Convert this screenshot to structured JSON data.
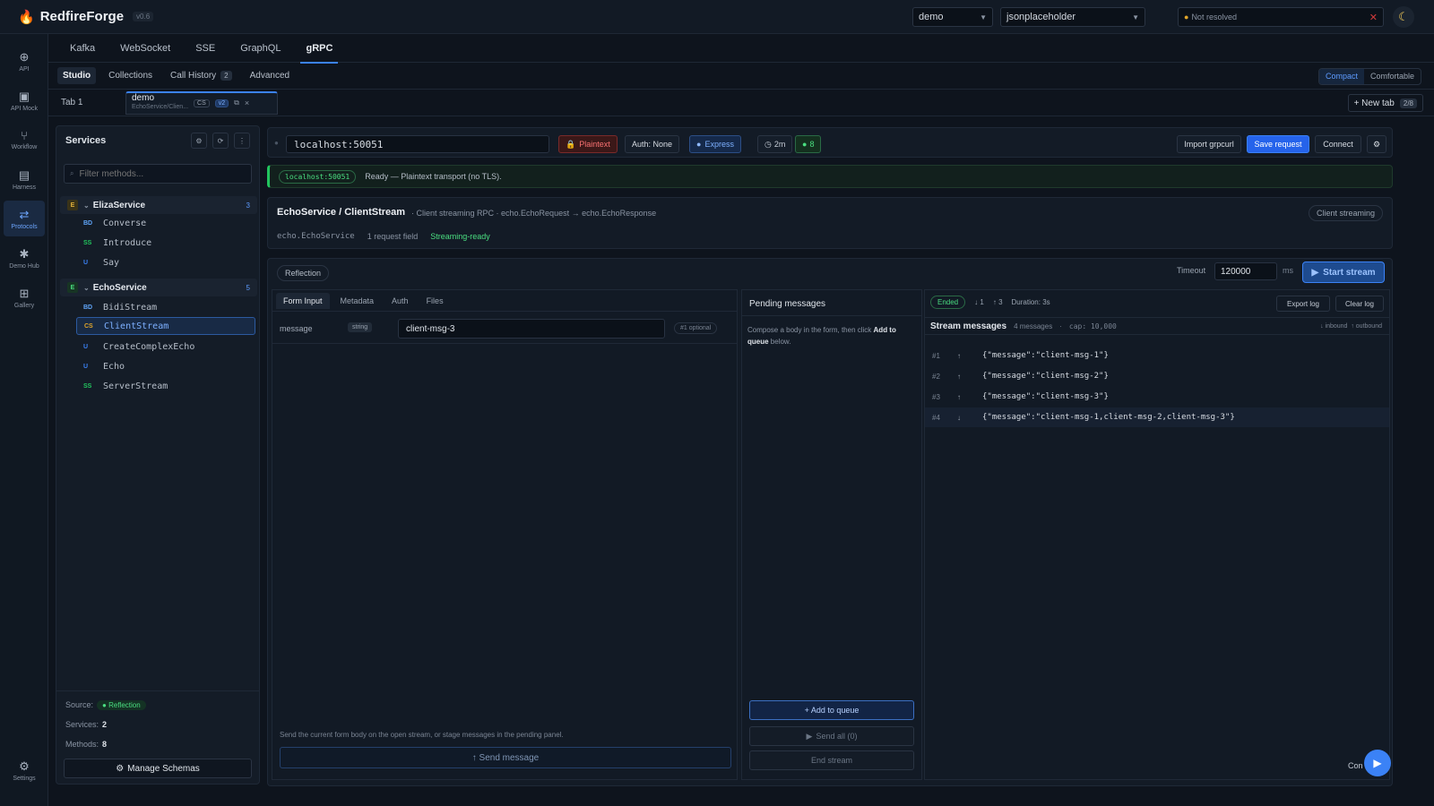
{
  "app": {
    "name": "RedfireForge",
    "version": "v0.6"
  },
  "topbar": {
    "workspace": "demo",
    "collection": "jsonplaceholder",
    "env_status": "Not resolved",
    "theme_icon": "moon-icon"
  },
  "rail": [
    {
      "label": "API",
      "icon": "globe-icon"
    },
    {
      "label": "API Mock",
      "icon": "mock-icon"
    },
    {
      "label": "Workflow",
      "icon": "workflow-icon"
    },
    {
      "label": "Harness",
      "icon": "harness-icon"
    },
    {
      "label": "Protocols",
      "icon": "protocols-icon",
      "active": true
    },
    {
      "label": "Demo Hub",
      "icon": "hub-icon"
    },
    {
      "label": "Gallery",
      "icon": "gallery-icon"
    },
    {
      "label": "Settings",
      "icon": "gear-icon"
    }
  ],
  "protocol_tabs": [
    "Kafka",
    "WebSocket",
    "SSE",
    "GraphQL",
    "gRPC"
  ],
  "active_protocol": "gRPC",
  "sub_tabs": {
    "studio": "Studio",
    "collections": "Collections",
    "history": "Call History",
    "history_count": "2",
    "advanced": "Advanced"
  },
  "density": {
    "compact": "Compact",
    "comfortable": "Comfortable"
  },
  "request_tabs": {
    "tab1": "Tab 1",
    "tab2_name": "demo",
    "tab2_sub": "EchoService/Clien...",
    "tab2_badge1": "CS",
    "tab2_badge2": "v2",
    "new_tab": "+ New tab",
    "tab_count": "2/8"
  },
  "services_panel": {
    "title": "Services",
    "filter_placeholder": "Filter methods...",
    "services": [
      {
        "name": "ElizaService",
        "count": "3",
        "methods": [
          {
            "tag": "BD",
            "name": "Converse"
          },
          {
            "tag": "SS",
            "name": "Introduce"
          },
          {
            "tag": "U",
            "name": "Say"
          }
        ]
      },
      {
        "name": "EchoService",
        "count": "5",
        "methods": [
          {
            "tag": "BD",
            "name": "BidiStream"
          },
          {
            "tag": "CS",
            "name": "ClientStream",
            "active": true
          },
          {
            "tag": "U",
            "name": "CreateComplexEcho"
          },
          {
            "tag": "U",
            "name": "Echo"
          },
          {
            "tag": "SS",
            "name": "ServerStream"
          }
        ]
      }
    ],
    "source_label": "Source:",
    "source_value": "Reflection",
    "services_label": "Services:",
    "services_count": "2",
    "methods_label": "Methods:",
    "methods_count": "8",
    "manage_button": "Manage Schemas"
  },
  "url_bar": {
    "url": "localhost:50051",
    "transport": "Plaintext",
    "auth": "Auth: None",
    "mode": "Express",
    "timer": "2m",
    "count": "8",
    "import_button": "Import grpcurl",
    "save_button": "Save request",
    "connect_button": "Connect"
  },
  "status": {
    "host": "localhost:50051",
    "message": "Ready — Plaintext transport (no TLS)."
  },
  "method": {
    "title": "EchoService / ClientStream",
    "subtitle": "· Client streaming RPC · echo.EchoRequest → echo.EchoResponse",
    "package": "echo.EchoService",
    "fields": "1 request field",
    "readiness": "Streaming-ready",
    "kind_badge": "Client streaming"
  },
  "workspace": {
    "reflection_tag": "Reflection",
    "timeout_label": "Timeout",
    "timeout_value": "120000",
    "timeout_unit": "ms",
    "start_button": "Start stream",
    "form_tabs": [
      "Form Input",
      "Metadata",
      "Auth",
      "Files"
    ],
    "field": {
      "name": "message",
      "type": "string",
      "value": "client-msg-3",
      "optional": "#1 optional"
    },
    "hint": "Send the current form body on the open stream, or stage messages in the pending panel.",
    "send_button": "↑ Send message"
  },
  "pending": {
    "title": "Pending messages",
    "text_before": "Compose a body in the form, then click",
    "text_bold": "Add to queue",
    "text_after": "below.",
    "add_button": "+ Add to queue",
    "send_all_button": "Send all (0)",
    "end_button": "End stream"
  },
  "stream": {
    "state": "Ended",
    "inbound": "1",
    "outbound": "3",
    "duration": "Duration: 3s",
    "export_button": "Export log",
    "clear_button": "Clear log",
    "title": "Stream messages",
    "msg_count": "4 messages",
    "cap": "cap: 10,000",
    "legend_in": "↓ inbound",
    "legend_out": "↑ outbound",
    "messages": [
      {
        "no": "#1",
        "dir": "↑",
        "body": "{\"message\":\"client-msg-1\"}"
      },
      {
        "no": "#2",
        "dir": "↑",
        "body": "{\"message\":\"client-msg-2\"}"
      },
      {
        "no": "#3",
        "dir": "↑",
        "body": "{\"message\":\"client-msg-3\"}"
      },
      {
        "no": "#4",
        "dir": "↓",
        "body": "{\"message\":\"client-msg-1,client-msg-2,client-msg-3\"}"
      }
    ]
  },
  "fab_label": "Con"
}
